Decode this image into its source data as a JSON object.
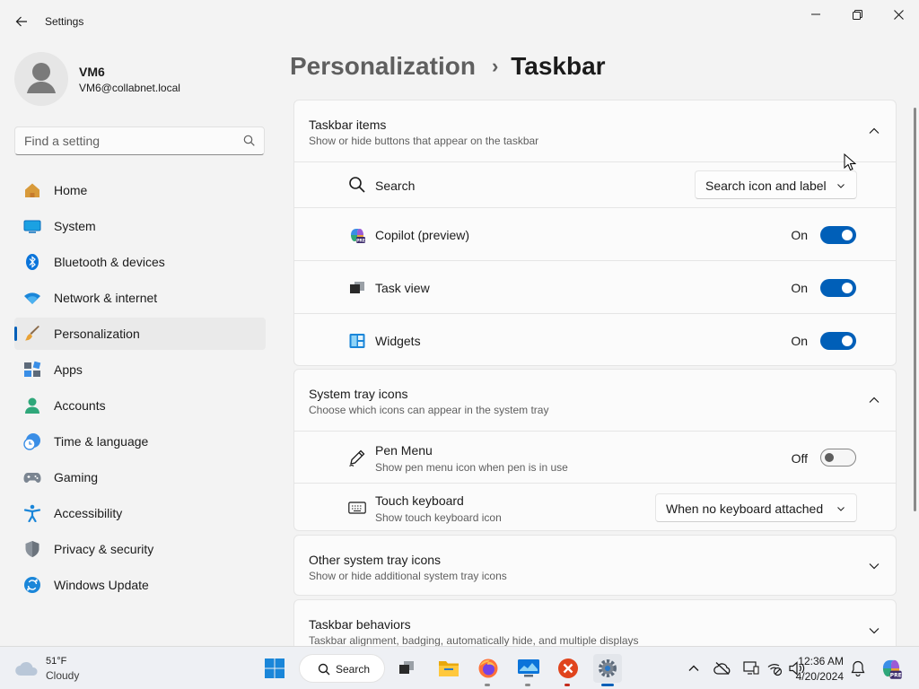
{
  "window": {
    "title": "Settings",
    "controls": [
      "minimize",
      "maximize",
      "close"
    ]
  },
  "user": {
    "name": "VM6",
    "email": "VM6@collabnet.local"
  },
  "search": {
    "placeholder": "Find a setting"
  },
  "nav": {
    "items": [
      {
        "label": "Home",
        "icon": "home-icon"
      },
      {
        "label": "System",
        "icon": "system-icon"
      },
      {
        "label": "Bluetooth & devices",
        "icon": "bluetooth-icon"
      },
      {
        "label": "Network & internet",
        "icon": "wifi-icon"
      },
      {
        "label": "Personalization",
        "icon": "brush-icon",
        "active": true
      },
      {
        "label": "Apps",
        "icon": "apps-icon"
      },
      {
        "label": "Accounts",
        "icon": "accounts-icon"
      },
      {
        "label": "Time & language",
        "icon": "clock-globe-icon"
      },
      {
        "label": "Gaming",
        "icon": "gamepad-icon"
      },
      {
        "label": "Accessibility",
        "icon": "accessibility-icon"
      },
      {
        "label": "Privacy & security",
        "icon": "shield-icon"
      },
      {
        "label": "Windows Update",
        "icon": "update-icon"
      }
    ]
  },
  "breadcrumb": {
    "parent": "Personalization",
    "separator": "›",
    "current": "Taskbar"
  },
  "sections": {
    "taskbar_items": {
      "title": "Taskbar items",
      "subtitle": "Show or hide buttons that appear on the taskbar",
      "expanded": true,
      "rows": {
        "search": {
          "label": "Search",
          "value": "Search icon and label"
        },
        "copilot": {
          "label": "Copilot (preview)",
          "state": "On",
          "on": true
        },
        "task_view": {
          "label": "Task view",
          "state": "On",
          "on": true
        },
        "widgets": {
          "label": "Widgets",
          "state": "On",
          "on": true
        }
      }
    },
    "system_tray": {
      "title": "System tray icons",
      "subtitle": "Choose which icons can appear in the system tray",
      "expanded": true,
      "rows": {
        "pen_menu": {
          "label": "Pen Menu",
          "subtitle": "Show pen menu icon when pen is in use",
          "state": "Off",
          "on": false
        },
        "touch_keyboard": {
          "label": "Touch keyboard",
          "subtitle": "Show touch keyboard icon",
          "value": "When no keyboard attached"
        }
      }
    },
    "other_tray": {
      "title": "Other system tray icons",
      "subtitle": "Show or hide additional system tray icons",
      "expanded": false
    },
    "behaviors": {
      "title": "Taskbar behaviors",
      "subtitle": "Taskbar alignment, badging, automatically hide, and multiple displays",
      "expanded": false
    }
  },
  "taskbar": {
    "weather": {
      "temp": "51°F",
      "condition": "Cloudy"
    },
    "search_label": "Search",
    "apps": [
      "start-icon",
      "search",
      "task-view-icon",
      "file-explorer-icon",
      "firefox-icon",
      "remote-desktop-icon",
      "error-app-icon",
      "settings-icon"
    ],
    "tray": [
      "chevron-up-icon",
      "onedrive-offline-icon",
      "display-icon",
      "network-disconnected-icon",
      "volume-icon",
      "notifications-icon",
      "copilot-icon"
    ],
    "clock": {
      "time": "12:36 AM",
      "date": "4/20/2024"
    }
  },
  "colors": {
    "accent": "#005fb8",
    "window_bg": "#f3f3f3",
    "card_bg": "#fbfbfb",
    "taskbar_bg": "#eef0f4"
  }
}
